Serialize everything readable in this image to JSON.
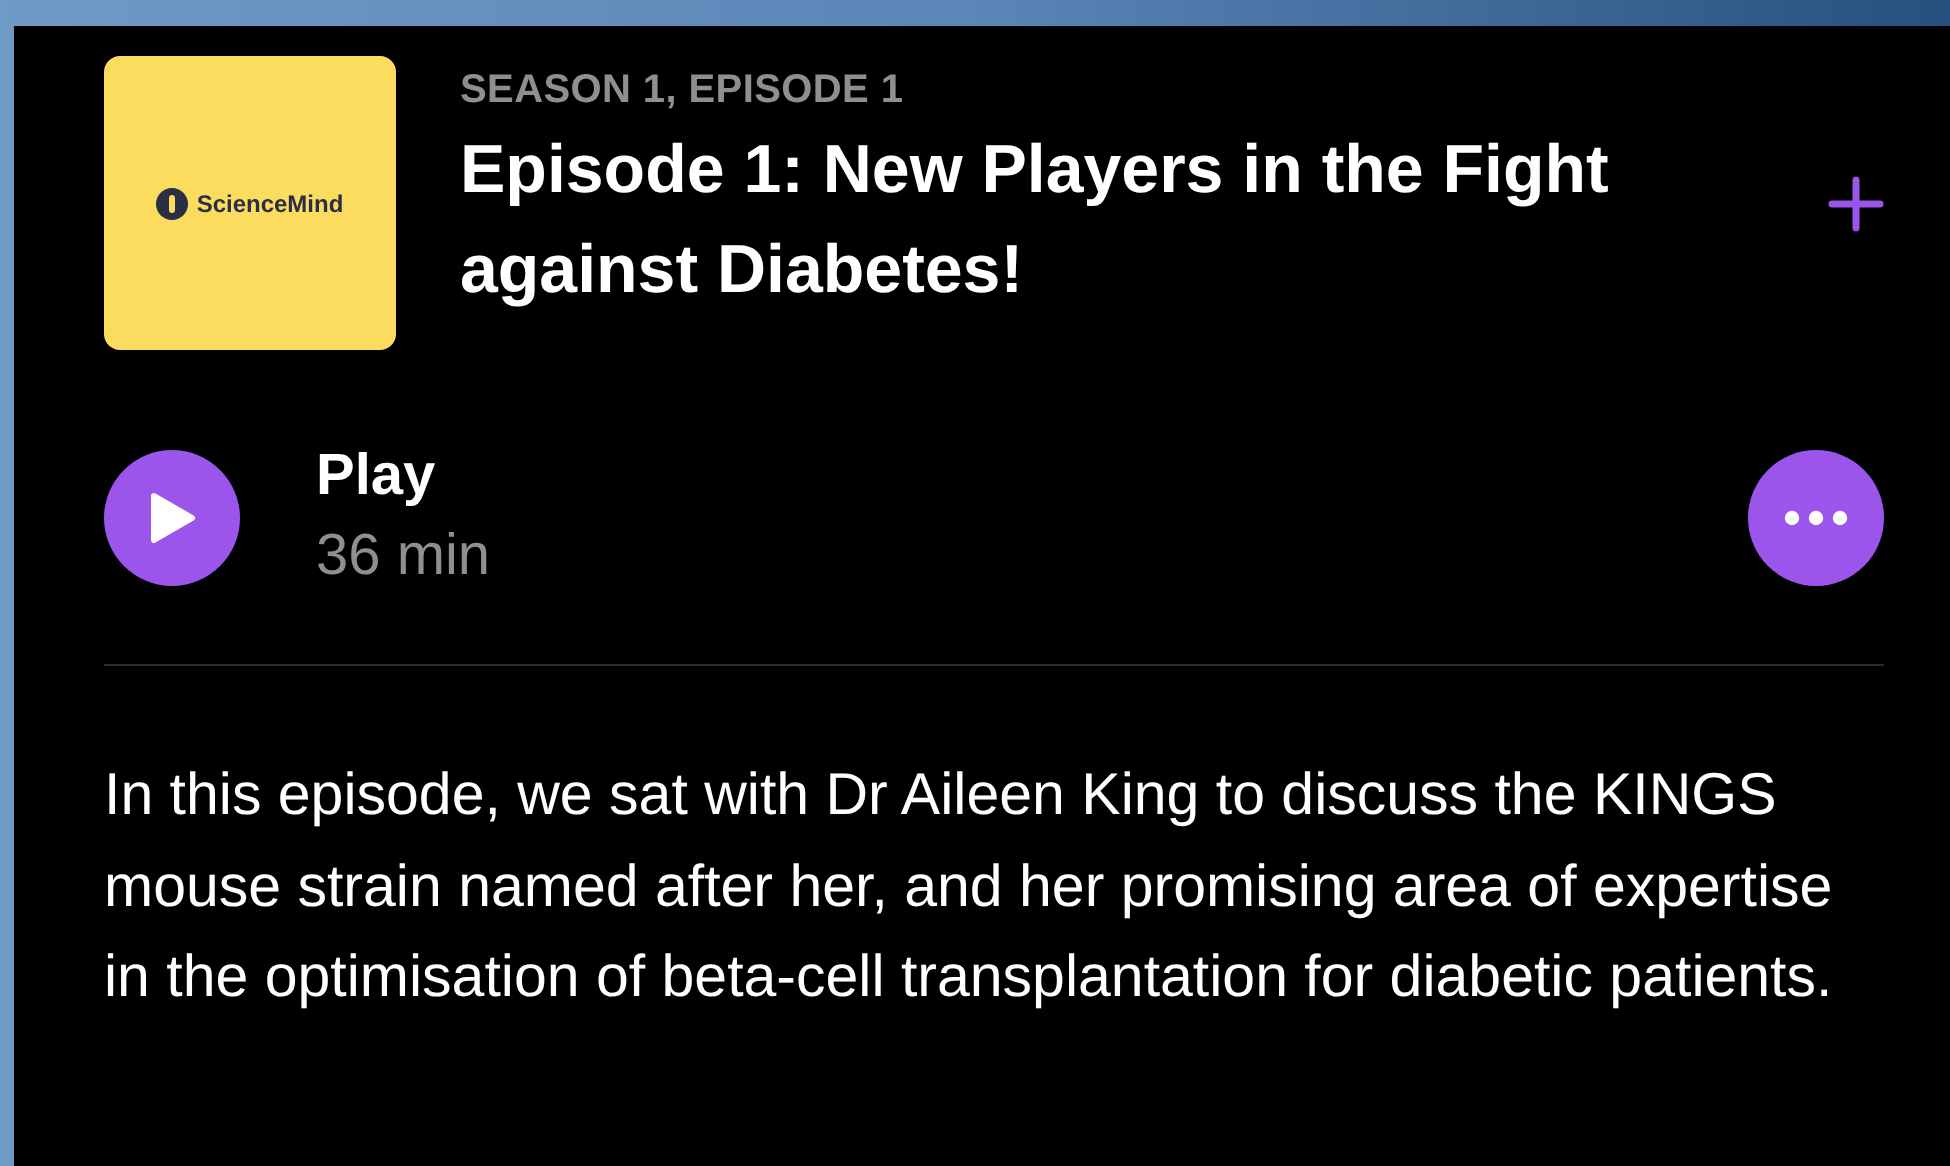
{
  "episode": {
    "artwork": {
      "brand": "ScienceMind"
    },
    "season_label": "SEASON 1, EPISODE 1",
    "title": "Episode 1: New Players in the Fight against Diabetes!",
    "play": {
      "label": "Play",
      "duration": "36 min"
    },
    "description": "In this episode, we sat with Dr Aileen King to discuss the KINGS mouse strain named after her, and her promising area of expertise in the optimisation of beta-cell transplantation for diabetic patients."
  }
}
